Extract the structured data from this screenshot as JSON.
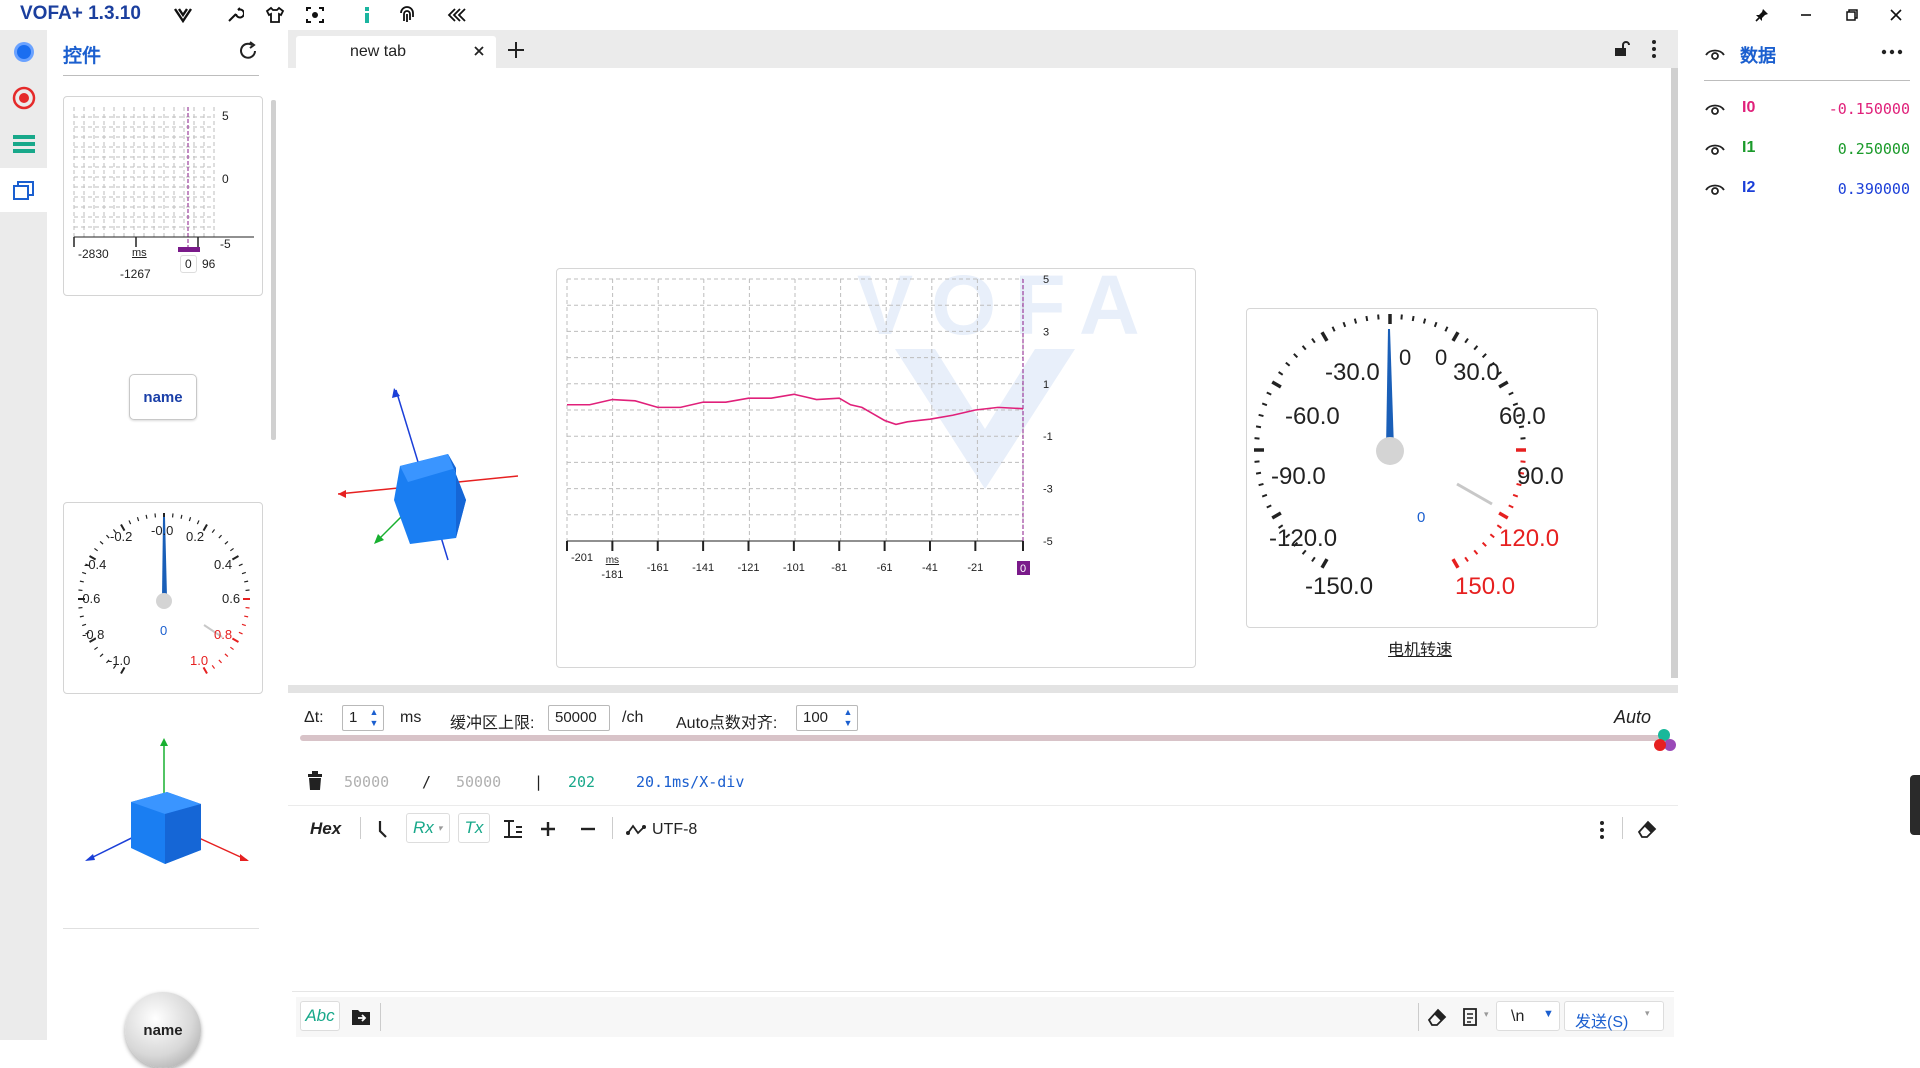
{
  "app": {
    "title": "VOFA+ 1.3.10"
  },
  "titlebar": {
    "icons": [
      "vofa-logo-icon",
      "wrench-icon",
      "shirt-icon",
      "capture-icon",
      "info-icon",
      "fingerprint-icon",
      "collapse-icon"
    ],
    "window_buttons": [
      "pin-icon",
      "minimize-icon",
      "restore-icon",
      "close-icon"
    ]
  },
  "activity_bar": {
    "items": [
      "protocol-icon",
      "record-icon",
      "list-icon",
      "widgets-icon"
    ]
  },
  "widgets_panel": {
    "title": "控件",
    "waveform_card": {
      "ticks_y": [
        "5",
        "0",
        "-5"
      ],
      "tick_x_left": "-2830",
      "tick_x_bottom": "-1267",
      "unit": "ms",
      "marker": "0",
      "marker_suffix": "96"
    },
    "button_label": "name",
    "dial": {
      "labels": [
        "-0.2",
        "-0.0",
        "0.2",
        "-0.4",
        "0.4",
        "-0.6",
        "0.6",
        "-0.8",
        "0.8",
        "-1.0",
        "1.0"
      ],
      "value": "0"
    },
    "round_button_label": "name"
  },
  "tabs": [
    {
      "label": "new tab"
    }
  ],
  "main_chart": {
    "watermark": "VOFA",
    "chart_data": {
      "type": "line",
      "xlabel": "ms",
      "xticks": [
        "-201",
        "-181",
        "-161",
        "-141",
        "-121",
        "-101",
        "-81",
        "-61",
        "-41",
        "-21",
        "0"
      ],
      "yticks": [
        "5",
        "3",
        "1",
        "-1",
        "-3",
        "-5"
      ],
      "ylim": [
        -5,
        5
      ],
      "xlim": [
        -201,
        0
      ],
      "series": [
        {
          "color": "#e0207a",
          "x": [
            -201,
            -191,
            -181,
            -171,
            -161,
            -151,
            -141,
            -131,
            -121,
            -111,
            -101,
            -96,
            -91,
            -81,
            -76,
            -71,
            -66,
            -61,
            -56,
            -51,
            -46,
            -41,
            -31,
            -21,
            -11,
            0
          ],
          "values": [
            0.2,
            0.2,
            0.4,
            0.35,
            0.1,
            0.1,
            0.3,
            0.3,
            0.45,
            0.45,
            0.6,
            0.5,
            0.4,
            0.45,
            0.2,
            0.1,
            -0.15,
            -0.4,
            -0.55,
            -0.45,
            -0.4,
            -0.35,
            -0.2,
            0.0,
            0.1,
            0.05
          ]
        }
      ],
      "grid": true
    }
  },
  "gauge": {
    "labels_left": [
      "-30.0",
      "-60.0",
      "-90.0",
      "-120.0",
      "-150.0"
    ],
    "labels_right": [
      "30.0",
      "60.0",
      "90.0",
      "120.0",
      "150.0"
    ],
    "top_labels": [
      "0",
      "0"
    ],
    "value": "0",
    "caption": "电机转速"
  },
  "controls": {
    "dt_label": "Δt:",
    "dt_value": "1",
    "dt_unit": "ms",
    "buffer_label": "缓冲区上限:",
    "buffer_value": "50000",
    "buffer_unit": "/ch",
    "auto_align_label": "Auto点数对齐:",
    "auto_align_value": "100",
    "auto_label": "Auto",
    "stats": {
      "count_a": "50000",
      "slash": "/",
      "count_b": "50000",
      "bar": "|",
      "points": "202",
      "xdiv": "20.1ms/X-div"
    },
    "toolbar": {
      "hex": "Hex",
      "rx": "Rx",
      "tx": "Tx",
      "encoding": "UTF-8"
    },
    "send": {
      "abc": "Abc",
      "newline": "\\n",
      "send_label": "发送(S)"
    }
  },
  "data_panel": {
    "title": "数据",
    "channels": [
      {
        "name": "I0",
        "value": "-0.150000",
        "color": "#e0207a"
      },
      {
        "name": "I1",
        "value": "0.250000",
        "color": "#1a9a2a"
      },
      {
        "name": "I2",
        "value": "0.390000",
        "color": "#1b3fd8"
      }
    ]
  }
}
